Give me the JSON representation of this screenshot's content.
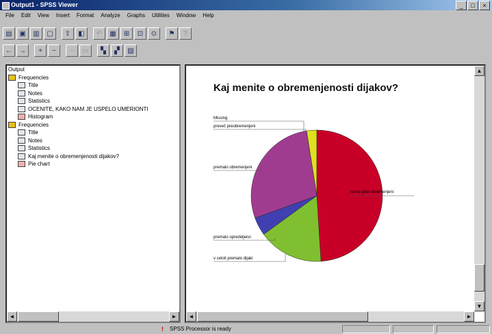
{
  "window": {
    "title": "Output1 - SPSS Viewer",
    "buttons": [
      "_",
      "□",
      "×"
    ]
  },
  "menu": [
    "File",
    "Edit",
    "View",
    "Insert",
    "Format",
    "Analyze",
    "Graphs",
    "Utilities",
    "Window",
    "Help"
  ],
  "outline": {
    "items": [
      {
        "label": "Output",
        "indent": 0,
        "icon": "none"
      },
      {
        "label": "Frequencies",
        "indent": 0,
        "icon": "book"
      },
      {
        "label": "Title",
        "indent": 1,
        "icon": "page"
      },
      {
        "label": "Notes",
        "indent": 1,
        "icon": "page"
      },
      {
        "label": "Statistics",
        "indent": 1,
        "icon": "page"
      },
      {
        "label": "OCENITE, KAKO NAM JE USPELO UMERIONTI",
        "indent": 1,
        "icon": "page"
      },
      {
        "label": "Histogram",
        "indent": 1,
        "icon": "chart"
      },
      {
        "label": "Frequencies",
        "indent": 0,
        "icon": "book"
      },
      {
        "label": "Title",
        "indent": 1,
        "icon": "page"
      },
      {
        "label": "Notes",
        "indent": 1,
        "icon": "page"
      },
      {
        "label": "Statistics",
        "indent": 1,
        "icon": "page"
      },
      {
        "label": "Kaj menite o obremenjenosti dijakov?",
        "indent": 1,
        "icon": "page"
      },
      {
        "label": "Pie chart",
        "indent": 1,
        "icon": "chart"
      }
    ]
  },
  "chart_data": {
    "type": "pie",
    "title": "Kaj menite o obremenjenosti dijakov?",
    "categories": [
      "Missing",
      "preveč preobremenjeni",
      "ravno prav obremenjeni",
      "premalo obremenjeni",
      "premalo opredeljeno",
      "v celoti premalo dijaki"
    ],
    "slices": [
      {
        "label": "Missing",
        "value": 2.5,
        "color": "#e0e020"
      },
      {
        "label": "preveč preobremenjeni",
        "value": 49,
        "color": "#c80028"
      },
      {
        "label": "ravno prav obremenjeni",
        "value": 16,
        "color": "#80c030"
      },
      {
        "label": "premalo opredeljeno",
        "value": 4.5,
        "color": "#4040b0"
      },
      {
        "label": "premalo obremenjeni",
        "value": 28,
        "color": "#a03c90"
      }
    ],
    "labels_left": [
      {
        "text": "Missing"
      },
      {
        "text": "preveč preobremenjeni"
      },
      {
        "text": "premalo obremenjeni"
      },
      {
        "text": "premalo opredeljeno"
      },
      {
        "text": "v celoti premalo dijaki"
      }
    ],
    "label_right": "ravno prav obremenjeni",
    "legend": "none"
  },
  "status": {
    "text": "SPSS Processor is ready",
    "icon": "warning-icon"
  }
}
